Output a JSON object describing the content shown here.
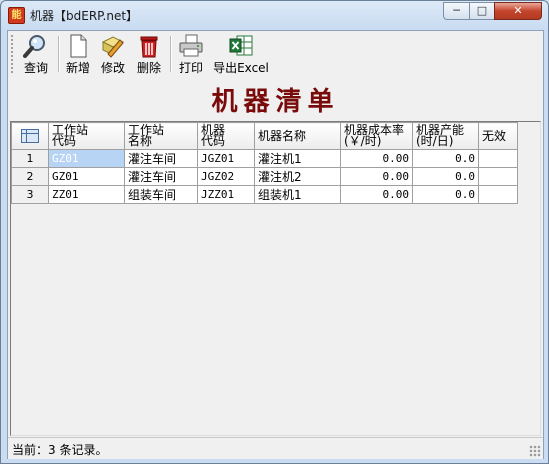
{
  "window": {
    "title": "机器【bdERP.net】",
    "app_icon_text": "能",
    "controls": {
      "minimize": "─",
      "maximize": "□",
      "close": "✕"
    }
  },
  "toolbar": {
    "buttons": [
      {
        "label": "查询",
        "icon": "magnifier-icon"
      },
      {
        "label": "新增",
        "icon": "new-document-icon"
      },
      {
        "label": "修改",
        "icon": "edit-pencil-icon"
      },
      {
        "label": "删除",
        "icon": "trash-icon"
      },
      {
        "label": "打印",
        "icon": "printer-icon"
      },
      {
        "label": "导出Excel",
        "icon": "excel-icon"
      }
    ]
  },
  "report_title": "机器清单",
  "table": {
    "headers": {
      "workstation_code": "工作站\n代码",
      "workstation_name": "工作站\n名称",
      "machine_code": "机器\n代码",
      "machine_name": "机器名称",
      "machine_cost_rate": "机器成本率\n(￥/时)",
      "machine_capacity": "机器产能\n(时/日)",
      "invalid": "无效"
    },
    "rows": [
      {
        "no": "1",
        "workstation_code": "GZ01",
        "workstation_name": "灌注车间",
        "machine_code": "JGZ01",
        "machine_name": "灌注机1",
        "cost_rate": "0.00",
        "capacity": "0.0",
        "invalid": ""
      },
      {
        "no": "2",
        "workstation_code": "GZ01",
        "workstation_name": "灌注车间",
        "machine_code": "JGZ02",
        "machine_name": "灌注机2",
        "cost_rate": "0.00",
        "capacity": "0.0",
        "invalid": ""
      },
      {
        "no": "3",
        "workstation_code": "ZZ01",
        "workstation_name": "组装车间",
        "machine_code": "JZZ01",
        "machine_name": "组装机1",
        "cost_rate": "0.00",
        "capacity": "0.0",
        "invalid": ""
      }
    ]
  },
  "status": {
    "text": "当前：3 条记录。"
  },
  "colors": {
    "title_red": "#7a0b0b",
    "selection": "#b8d4f4"
  }
}
